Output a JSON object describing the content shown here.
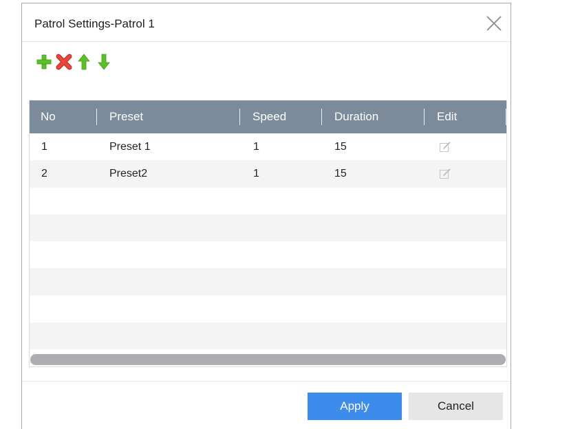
{
  "dialog": {
    "title": "Patrol Settings-Patrol 1"
  },
  "toolbar": {
    "icons": [
      "add-icon",
      "delete-icon",
      "move-up-icon",
      "move-down-icon"
    ],
    "colors": {
      "green": "#5cbf2a",
      "red": "#e23b2e"
    }
  },
  "table": {
    "columns": [
      "No",
      "Preset",
      "Speed",
      "Duration",
      "Edit"
    ],
    "rows": [
      {
        "no": "1",
        "preset": "Preset 1",
        "speed": "1",
        "duration": "15",
        "edit": "edit-icon"
      },
      {
        "no": "2",
        "preset": "Preset2",
        "speed": "1",
        "duration": "15",
        "edit": "edit-icon"
      }
    ],
    "header_color": "#7c8b9b"
  },
  "buttons": {
    "apply": "Apply",
    "cancel": "Cancel",
    "apply_color": "#3d8bea"
  }
}
